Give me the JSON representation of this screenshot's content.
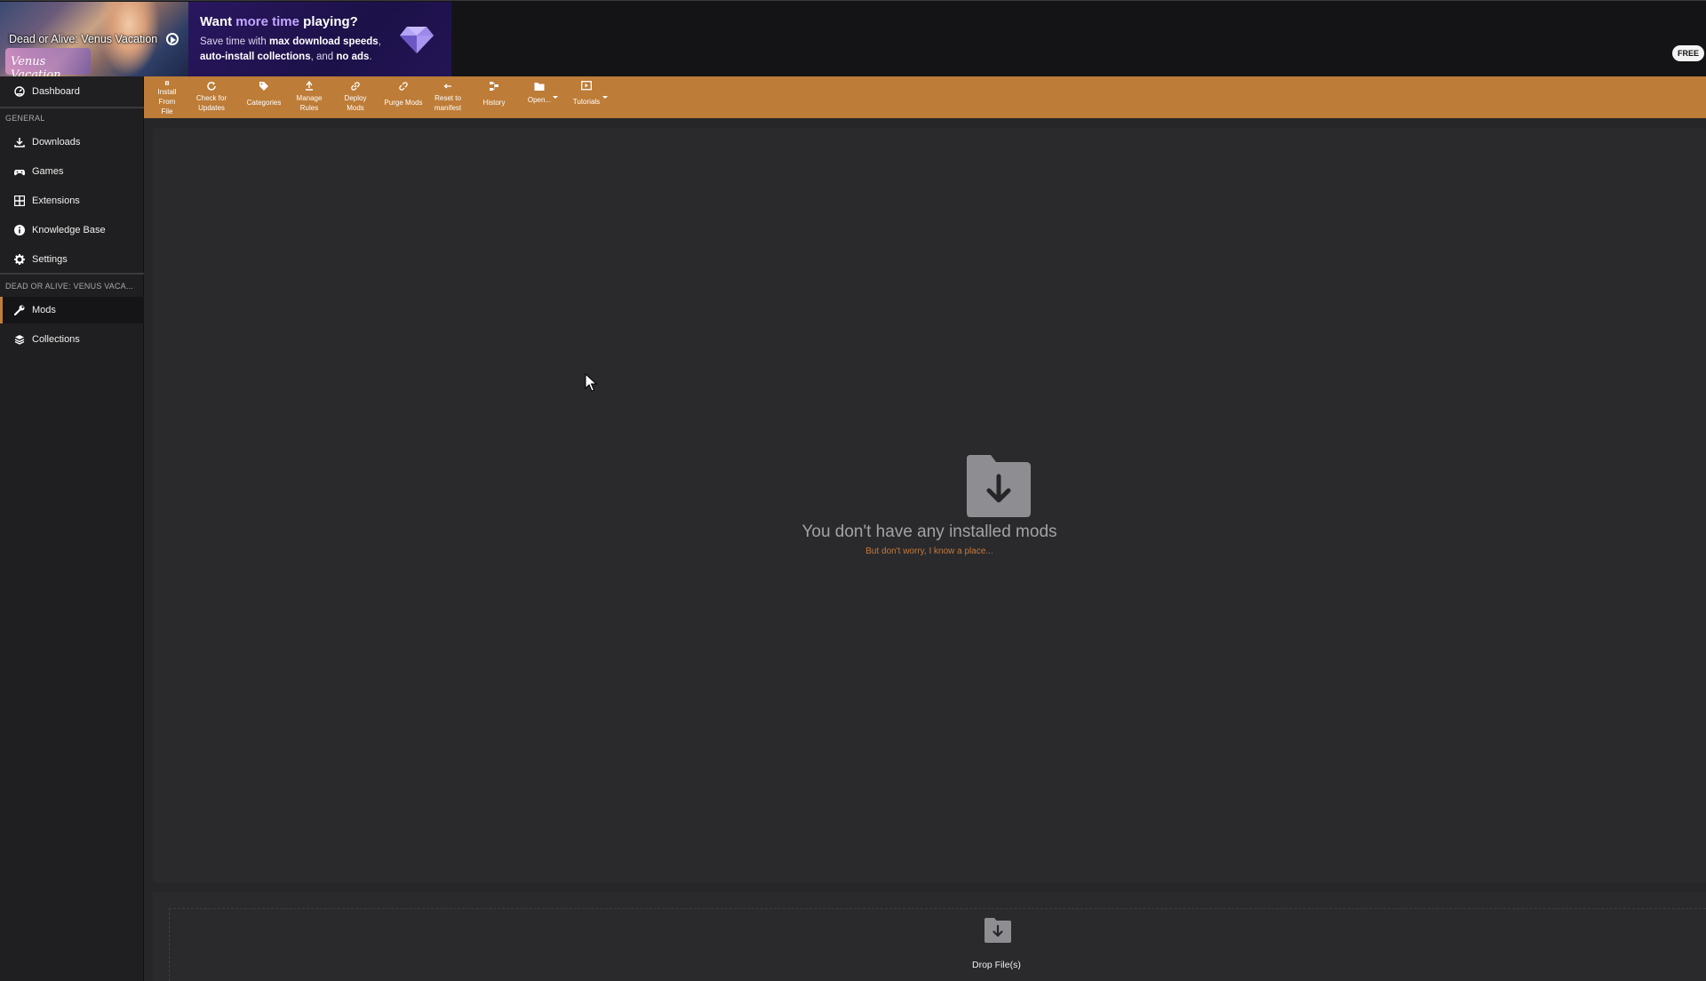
{
  "header": {
    "game_thumb": {
      "name": "Dead or Alive: Venus Vacation",
      "logo_text": "Venus Vacation"
    },
    "promo": {
      "title_prefix": "Want ",
      "title_highlight": "more time",
      "title_suffix": " playing?",
      "line1_prefix": "Save time with ",
      "line1_bold": "max download speeds",
      "line1_suffix": ",",
      "line2_bold1": "auto-install collections",
      "line2_mid": ", and ",
      "line2_bold2": "no ads",
      "line2_suffix": "."
    },
    "badge": "FREE"
  },
  "sidebar": {
    "dashboard": "Dashboard",
    "general_label": "GENERAL",
    "general_items": [
      {
        "label": "Downloads",
        "icon": "download-icon"
      },
      {
        "label": "Games",
        "icon": "gamepad-icon"
      },
      {
        "label": "Extensions",
        "icon": "grid-icon"
      },
      {
        "label": "Knowledge Base",
        "icon": "info-icon"
      },
      {
        "label": "Settings",
        "icon": "gear-icon"
      }
    ],
    "game_label": "DEAD OR ALIVE: VENUS VACA...",
    "game_items": [
      {
        "label": "Mods",
        "icon": "wrench-icon",
        "active": true
      },
      {
        "label": "Collections",
        "icon": "layers-icon"
      }
    ]
  },
  "toolbar": {
    "install_from_file": [
      "Install From",
      "File"
    ],
    "check_for_updates": [
      "Check for",
      "Updates"
    ],
    "categories": "Categories",
    "manage_rules": [
      "Manage",
      "Rules"
    ],
    "deploy_mods": [
      "Deploy",
      "Mods"
    ],
    "purge_mods": "Purge Mods",
    "reset_to_manifest": [
      "Reset to",
      "manifest"
    ],
    "history": "History",
    "open": "Open...",
    "tutorials": "Tutorials"
  },
  "main": {
    "empty_title": "You don't have any installed mods",
    "empty_subtitle": "But don't worry, I know a place..."
  },
  "dropzone": {
    "label": "Drop File(s)"
  },
  "colors": {
    "accent": "#bd7c37",
    "link": "#c47a3c",
    "sidebar_bg": "#1f1f21",
    "main_bg": "#262628"
  }
}
